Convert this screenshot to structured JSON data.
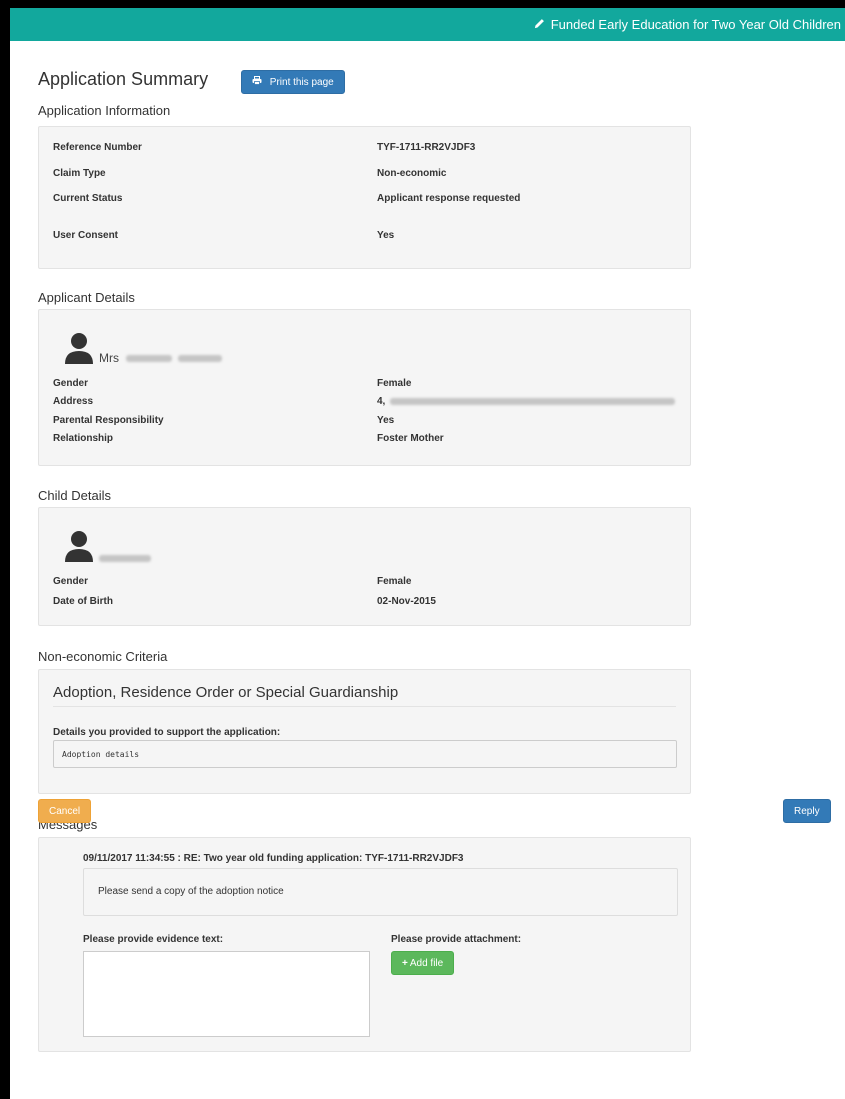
{
  "header": {
    "title": "Funded Early Education for Two Year Old Children"
  },
  "page": {
    "title": "Application Summary",
    "print_label": "Print this page"
  },
  "application": {
    "section_title": "Application Information",
    "rows": [
      {
        "label": "Reference Number",
        "value": "TYF-1711-RR2VJDF3"
      },
      {
        "label": "Claim Type",
        "value": "Non-economic"
      },
      {
        "label": "Current Status",
        "value": "Applicant response requested"
      },
      {
        "label": "User Consent",
        "value": "Yes"
      }
    ]
  },
  "applicant": {
    "section_title": "Applicant Details",
    "title_prefix": "Mrs",
    "rows": [
      {
        "label": "Gender",
        "value": "Female"
      },
      {
        "label": "Address",
        "value": "4,"
      },
      {
        "label": "Parental Responsibility",
        "value": "Yes"
      },
      {
        "label": "Relationship",
        "value": "Foster Mother"
      }
    ]
  },
  "child": {
    "section_title": "Child Details",
    "rows": [
      {
        "label": "Gender",
        "value": "Female"
      },
      {
        "label": "Date of Birth",
        "value": "02-Nov-2015"
      }
    ]
  },
  "criteria": {
    "section_title": "Non-economic Criteria",
    "heading": "Adoption, Residence Order or Special Guardianship",
    "details_label": "Details you provided to support the application:",
    "details_value": "Adoption details"
  },
  "messages": {
    "section_title": "Messages",
    "message_header": "09/11/2017 11:34:55 : RE: Two year old funding application: TYF-1711-RR2VJDF3",
    "message_body": "Please send a copy of the adoption notice",
    "evidence_label": "Please provide evidence text:",
    "attachment_label": "Please provide attachment:",
    "add_file_label": "Add file"
  },
  "footer": {
    "cancel_label": "Cancel",
    "reply_label": "Reply"
  },
  "colors": {
    "header": "#12a89d",
    "primary": "#337ab7",
    "success": "#5cb85c",
    "warning": "#f0ad4e"
  },
  "icons": [
    "pencil-icon",
    "print-icon",
    "user-icon",
    "plus-icon"
  ]
}
